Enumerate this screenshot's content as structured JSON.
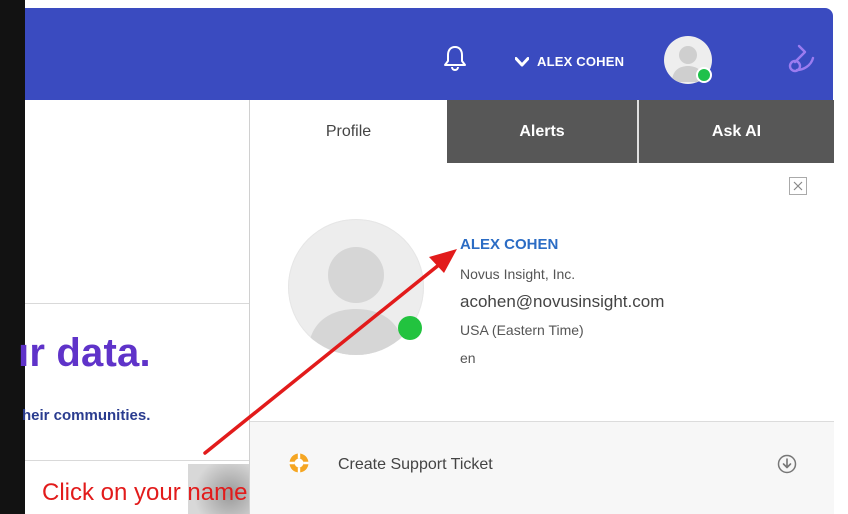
{
  "header": {
    "user_name": "ALEX COHEN",
    "icons": [
      "bell-icon",
      "chevron-down-icon",
      "avatar",
      "brand-icon"
    ]
  },
  "left": {
    "hero_text": "ır data.",
    "hero_sub": "heir communities."
  },
  "panel": {
    "tabs": [
      {
        "label": "Profile",
        "active": true
      },
      {
        "label": "Alerts",
        "active": false
      },
      {
        "label": "Ask AI",
        "active": false
      }
    ],
    "profile": {
      "name": "ALEX COHEN",
      "company": "Novus Insight, Inc.",
      "email": "acohen@novusinsight.com",
      "timezone": "USA (Eastern Time)",
      "language": "en"
    },
    "support": {
      "label": "Create Support Ticket"
    }
  },
  "annotation": {
    "text": "Click on your name",
    "color": "#e21b1b"
  },
  "colors": {
    "topbar": "#3a4bc0",
    "hero": "#5f33c9",
    "link": "#2b6cc4",
    "online": "#22c33f"
  }
}
